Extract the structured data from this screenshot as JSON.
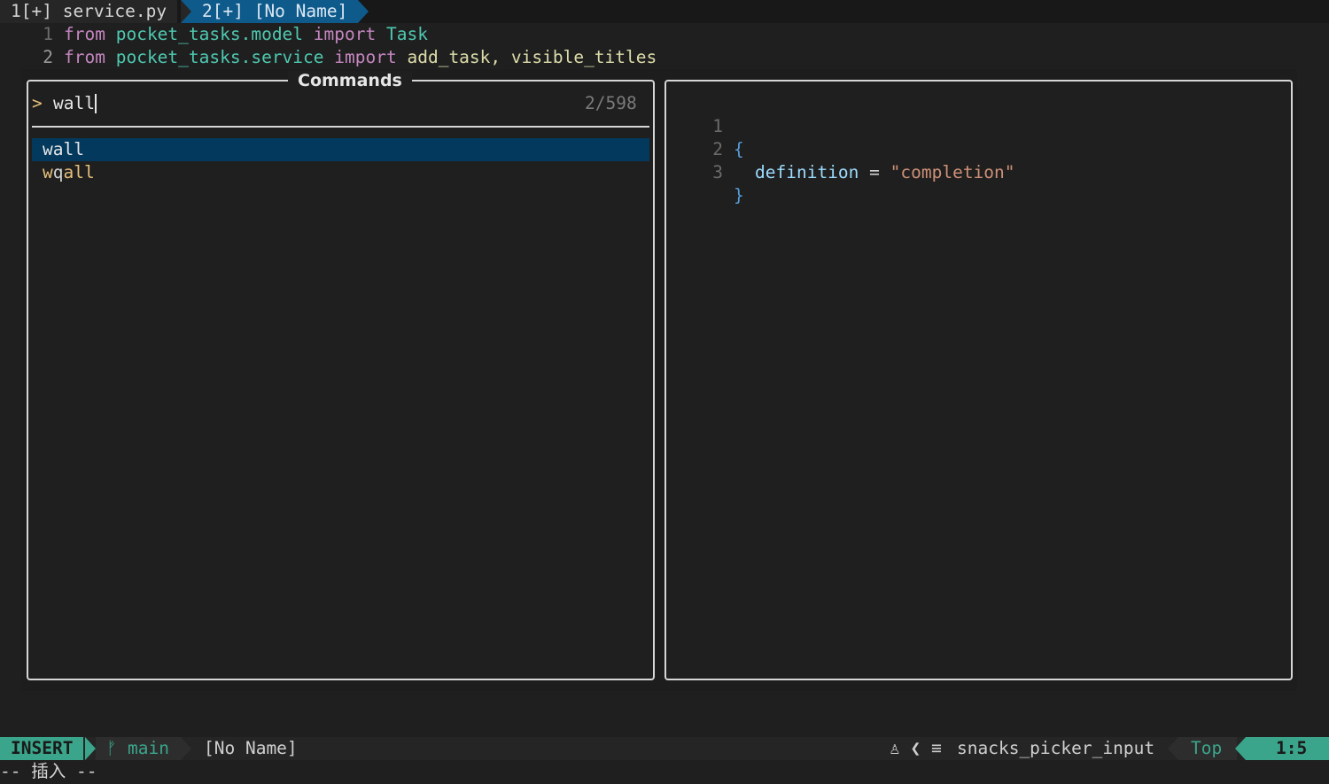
{
  "tabline": {
    "tab1": "1[+] service.py",
    "tab2": "2[+] [No Name]"
  },
  "buffer": {
    "lines": [
      {
        "num": "1",
        "kw1": "from",
        "module": "pocket_tasks.model",
        "kw2": "import",
        "names": "Task"
      },
      {
        "num": "2",
        "kw1": "from",
        "module": "pocket_tasks.service",
        "kw2": "import",
        "names": "add_task, visible_titles"
      }
    ]
  },
  "picker": {
    "title": "Commands",
    "prompt_icon": ">",
    "query": "wall",
    "count": "2/598",
    "items": [
      {
        "label": "wall",
        "selected": true
      },
      {
        "label": "wqall",
        "selected": false
      }
    ]
  },
  "preview": {
    "lines": [
      {
        "num": "1",
        "text": "{"
      },
      {
        "num": "2",
        "key": "definition",
        "op": " = ",
        "value": "\"completion\""
      },
      {
        "num": "3",
        "text": "}"
      }
    ]
  },
  "statusline": {
    "mode": "INSERT",
    "branch_icon": "ᚠ",
    "branch": "main",
    "filename": "[No Name]",
    "icons": "♙ ❮ ≡",
    "filetype": "snacks_picker_input",
    "position": "Top",
    "linecol": "1:5",
    "colors": {
      "accent": "#3aa58a",
      "selection": "#04395e",
      "tab_active": "#0e5a8a"
    }
  },
  "cmdline": "-- 插入 --"
}
